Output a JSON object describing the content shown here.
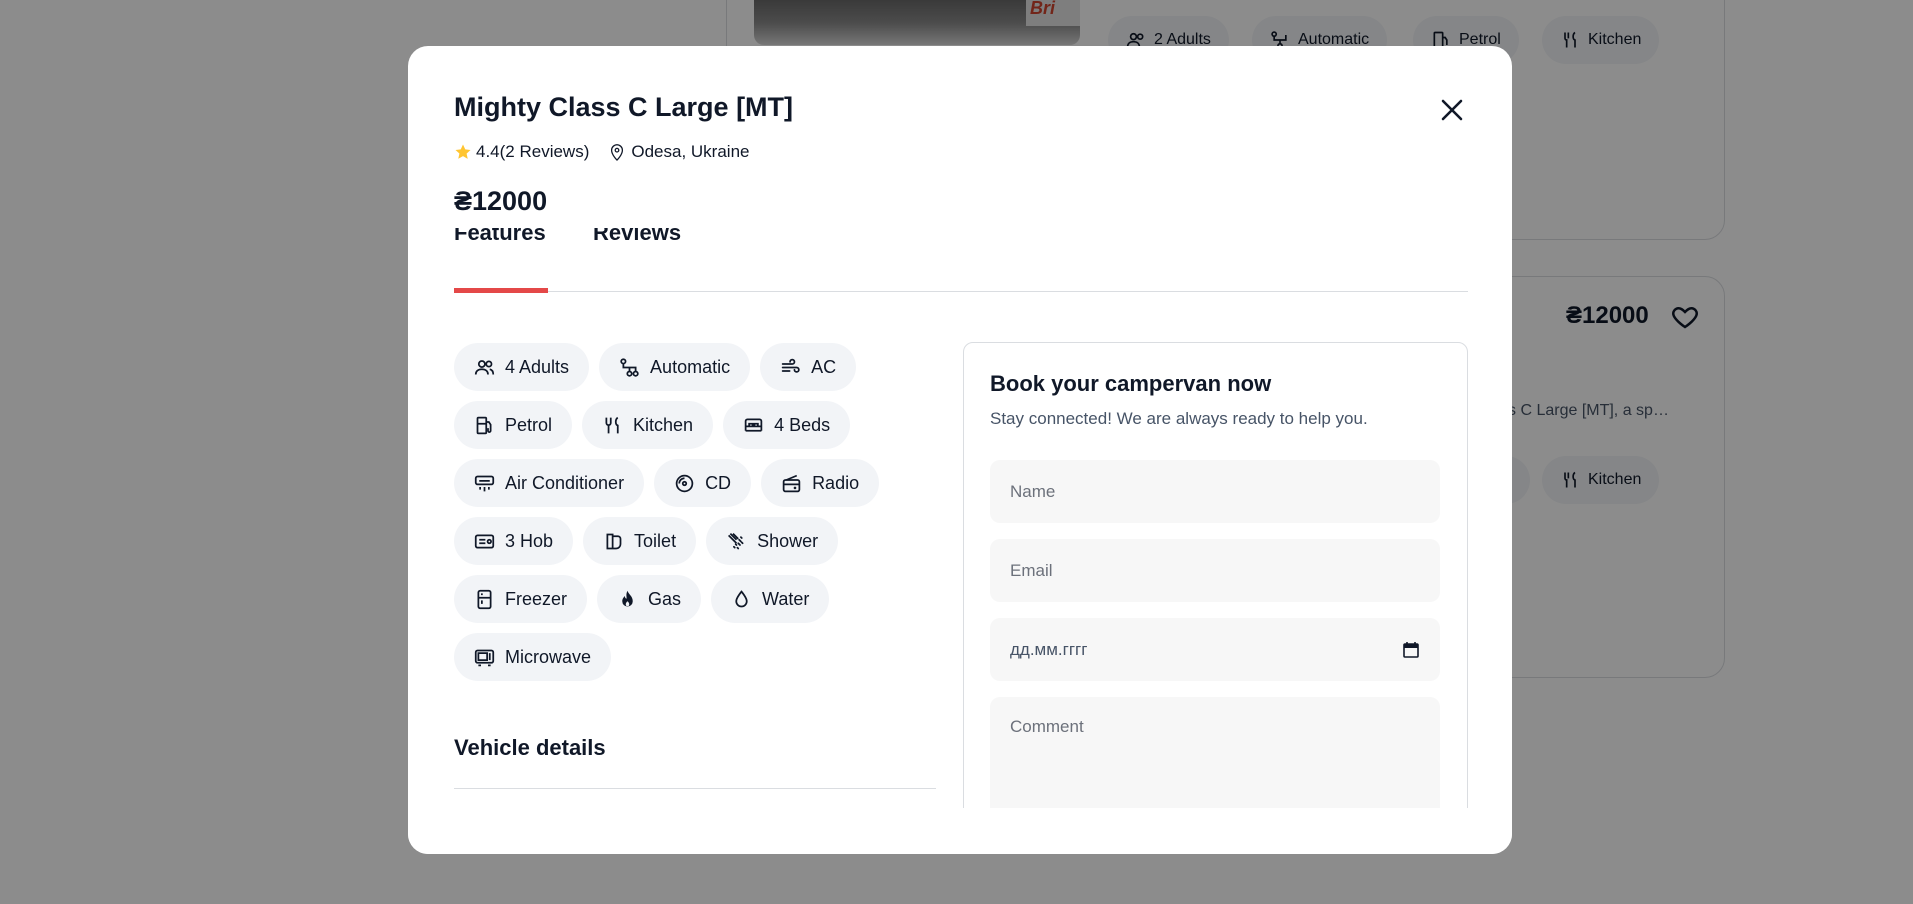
{
  "background": {
    "card1": {
      "brand_text": "Bri",
      "chips": [
        {
          "label": "2 Adults",
          "icon": "adults-icon"
        },
        {
          "label": "Automatic",
          "icon": "transmission-icon"
        },
        {
          "label": "Petrol",
          "icon": "fuel-icon"
        },
        {
          "label": "Kitchen",
          "icon": "kitchen-icon"
        }
      ]
    },
    "card2": {
      "price": "₴12000",
      "description": "s C Large [MT], a sp…",
      "chips": [
        {
          "label": "Kitchen",
          "icon": "kitchen-icon"
        }
      ]
    }
  },
  "modal": {
    "title": "Mighty Class C Large [MT]",
    "rating": "4.4(2 Reviews)",
    "location": "Odesa, Ukraine",
    "price": "₴12000",
    "tabs": [
      {
        "label": "Features",
        "active": true
      },
      {
        "label": "Reviews",
        "active": false
      }
    ],
    "features": [
      {
        "label": "4 Adults",
        "icon": "adults-icon"
      },
      {
        "label": "Automatic",
        "icon": "transmission-icon"
      },
      {
        "label": "AC",
        "icon": "ac-icon"
      },
      {
        "label": "Petrol",
        "icon": "fuel-icon"
      },
      {
        "label": "Kitchen",
        "icon": "kitchen-icon"
      },
      {
        "label": "4 Beds",
        "icon": "bed-icon"
      },
      {
        "label": "Air Conditioner",
        "icon": "air-conditioner-icon"
      },
      {
        "label": "CD",
        "icon": "cd-icon"
      },
      {
        "label": "Radio",
        "icon": "radio-icon"
      },
      {
        "label": "3 Hob",
        "icon": "hob-icon"
      },
      {
        "label": "Toilet",
        "icon": "toilet-icon"
      },
      {
        "label": "Shower",
        "icon": "shower-icon"
      },
      {
        "label": "Freezer",
        "icon": "freezer-icon"
      },
      {
        "label": "Gas",
        "icon": "gas-icon"
      },
      {
        "label": "Water",
        "icon": "water-icon"
      },
      {
        "label": "Microwave",
        "icon": "microwave-icon"
      }
    ],
    "vehicle_details_title": "Vehicle details",
    "booking": {
      "title": "Book your campervan now",
      "subtitle": "Stay connected! We are always ready to help you.",
      "name_placeholder": "Name",
      "email_placeholder": "Email",
      "date_placeholder": "дд.мм.гггг",
      "comment_placeholder": "Comment"
    }
  },
  "colors": {
    "accent": "#e44848",
    "star": "#ffc531",
    "chip_bg": "#f2f4f7",
    "input_bg": "#f7f7f7",
    "overlay": "rgba(0,0,0,0.45)"
  }
}
